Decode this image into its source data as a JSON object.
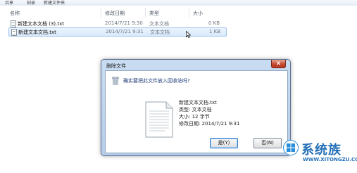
{
  "toolbar": {
    "items": [
      "共享",
      "刻录",
      "新建文件夹"
    ]
  },
  "columns": {
    "name": "名称",
    "date": "修改日期",
    "type": "类型",
    "size": "大小"
  },
  "files": [
    {
      "name": "新建文本文档 (3).txt",
      "date": "2014/7/21 9:30",
      "type": "文本文档",
      "size": "0 KB",
      "selected": false
    },
    {
      "name": "新建文本文档.txt",
      "date": "2014/7/21 9:31",
      "type": "文本文档",
      "size": "1 KB",
      "selected": true
    }
  ],
  "dialog": {
    "title": "删除文件",
    "close_label": "x",
    "question": "确实要把此文件放入回收站吗?",
    "details": [
      "新建文本文档.txt",
      "类型: 文本文档",
      "大小: 12 字节",
      "修改日期: 2014/7/21 9:31"
    ],
    "yes_label": "是(Y)",
    "no_label": "否(N)"
  },
  "watermark": {
    "brand": "系统族",
    "url": "WWW.XITONGZU.COM"
  },
  "colors": {
    "accent": "#2470b8",
    "dialog_frame": "#b6cde9",
    "selection": "#d9eafb"
  }
}
